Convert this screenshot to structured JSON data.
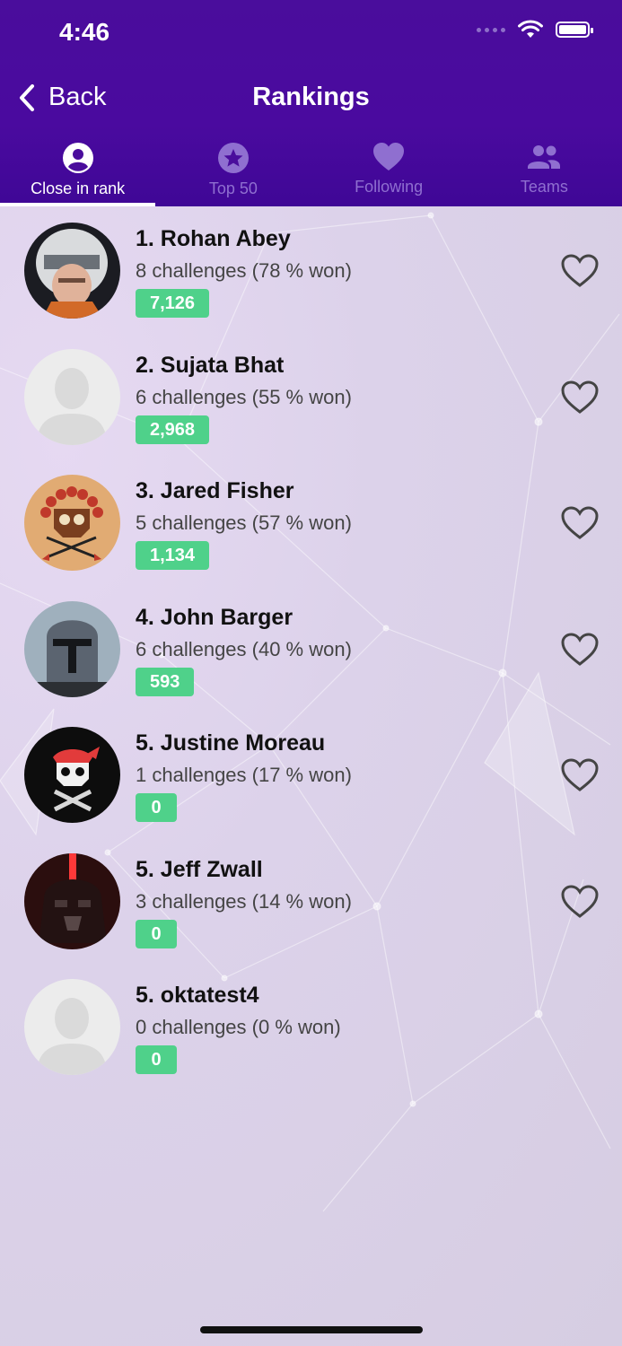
{
  "status_bar": {
    "time": "4:46"
  },
  "nav": {
    "back_label": "Back",
    "title": "Rankings"
  },
  "tabs": [
    {
      "label": "Close in rank",
      "icon": "person-circle-icon",
      "active": true
    },
    {
      "label": "Top 50",
      "icon": "star-circle-icon",
      "active": false
    },
    {
      "label": "Following",
      "icon": "heart-icon",
      "active": false
    },
    {
      "label": "Teams",
      "icon": "people-icon",
      "active": false
    }
  ],
  "colors": {
    "header": "#4a0d9c",
    "score_badge": "#4fd18a",
    "tab_inactive": "#8f6fd0"
  },
  "rankings": [
    {
      "name": "1. Rohan Abey",
      "stats": "8 challenges (78 % won)",
      "score": "7,126",
      "avatar": "pilot-helmet-avatar",
      "followable": true
    },
    {
      "name": "2. Sujata Bhat",
      "stats": "6 challenges (55 % won)",
      "score": "2,968",
      "avatar": "default-user-avatar",
      "followable": true
    },
    {
      "name": "3. Jared Fisher",
      "stats": "5 challenges (57 % won)",
      "score": "1,134",
      "avatar": "skull-headdress-avatar",
      "followable": true
    },
    {
      "name": "4. John Barger",
      "stats": "6 challenges (40 % won)",
      "score": "593",
      "avatar": "mandalorian-helmet-avatar",
      "followable": true
    },
    {
      "name": "5. Justine Moreau",
      "stats": "1 challenges (17 % won)",
      "score": "0",
      "avatar": "skull-bandana-avatar",
      "followable": true
    },
    {
      "name": "5. Jeff Zwall",
      "stats": "3 challenges (14 % won)",
      "score": "0",
      "avatar": "vader-helmet-avatar",
      "followable": true
    },
    {
      "name": "5. oktatest4",
      "stats": "0 challenges (0 % won)",
      "score": "0",
      "avatar": "default-user-avatar",
      "followable": false
    }
  ]
}
